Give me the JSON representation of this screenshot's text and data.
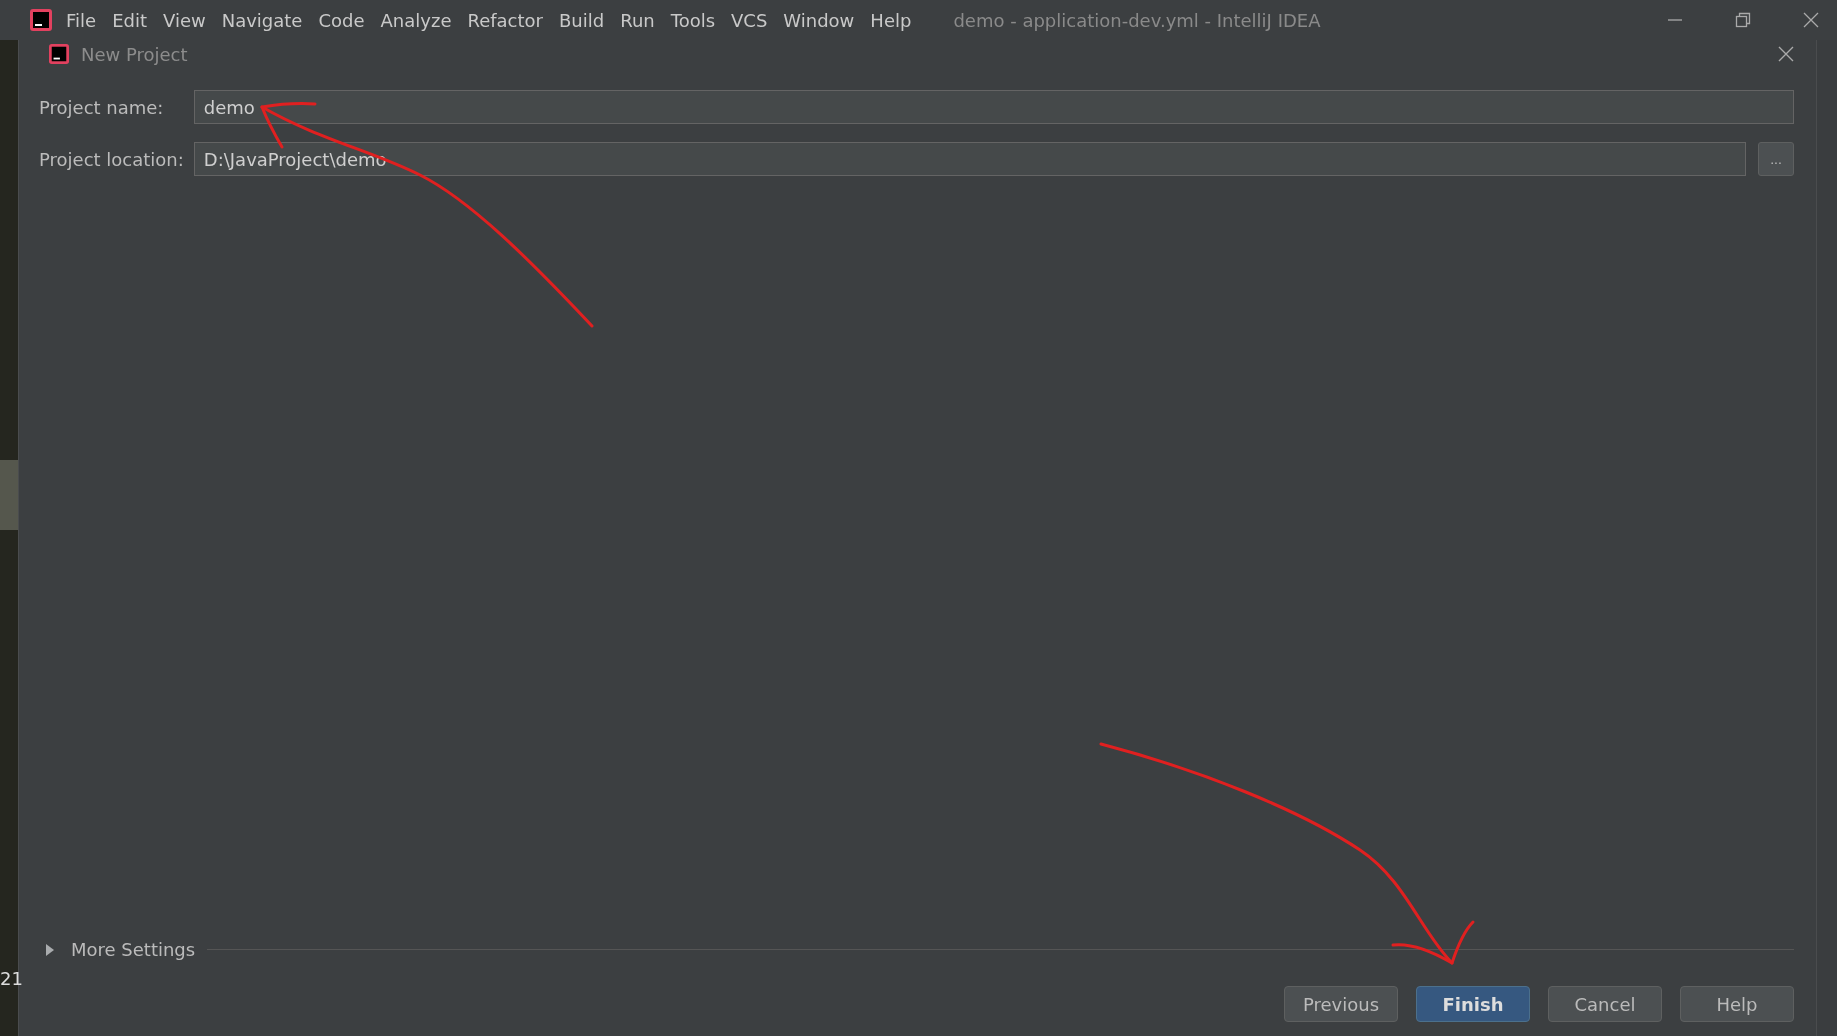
{
  "window": {
    "title": "demo - application-dev.yml - IntelliJ IDEA",
    "menu": [
      "File",
      "Edit",
      "View",
      "Navigate",
      "Code",
      "Analyze",
      "Refactor",
      "Build",
      "Run",
      "Tools",
      "VCS",
      "Window",
      "Help"
    ]
  },
  "background_editor": {
    "line_number": "21"
  },
  "dialog": {
    "title": "New Project",
    "fields": [
      {
        "label": "Project name:",
        "value": "demo",
        "kind": "text"
      },
      {
        "label": "Project location:",
        "value": "D:\\JavaProject\\demo",
        "kind": "browse",
        "browse_label": "..."
      }
    ],
    "more_settings": {
      "label": "More Settings",
      "expanded": false
    },
    "buttons": [
      {
        "label": "Previous",
        "default": false
      },
      {
        "label": "Finish",
        "default": true
      },
      {
        "label": "Cancel",
        "default": false
      },
      {
        "label": "Help",
        "default": false
      }
    ]
  }
}
